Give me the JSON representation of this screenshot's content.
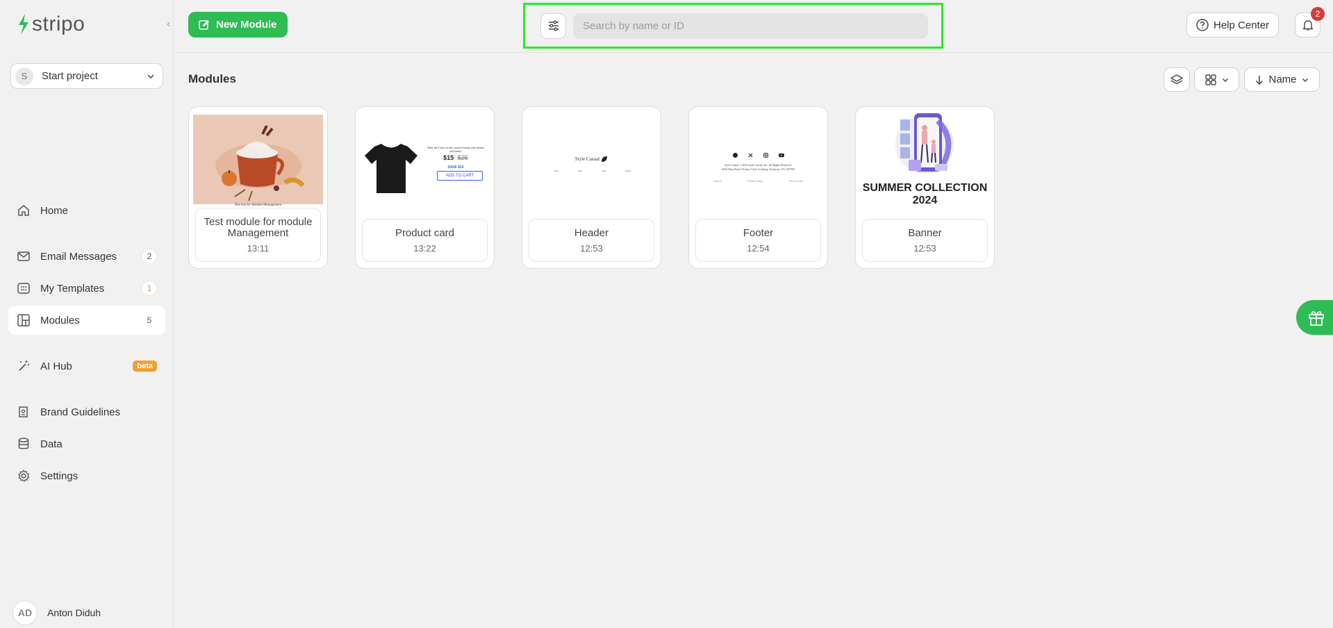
{
  "brand": {
    "logo_text": "stripo",
    "accent": "#2ebc54"
  },
  "project": {
    "avatar": "S",
    "name": "Start project"
  },
  "nav": {
    "home": {
      "label": "Home"
    },
    "email": {
      "label": "Email Messages",
      "count": "2"
    },
    "templates": {
      "label": "My Templates",
      "count": "1"
    },
    "modules": {
      "label": "Modules",
      "count": "5"
    },
    "ai": {
      "label": "AI Hub",
      "badge": "beta"
    },
    "brand": {
      "label": "Brand Guidelines"
    },
    "data": {
      "label": "Data"
    },
    "settings": {
      "label": "Settings"
    }
  },
  "user": {
    "initials": "AD",
    "name": "Anton Diduh"
  },
  "toolbar": {
    "new_module": "New Module"
  },
  "search": {
    "placeholder": "Search by name or ID"
  },
  "header": {
    "help": "Help Center",
    "notifications": "2"
  },
  "main": {
    "title": "Modules",
    "sort_label": "Name"
  },
  "cards": [
    {
      "name": "Test module for module Management",
      "time": "13:11",
      "thumb_caption": "Test text for Module Management"
    },
    {
      "name": "Product card",
      "time": "13:22",
      "thumb": {
        "text": "Wear the T-shirt on the casual evening with friends and family.",
        "price": "$15",
        "old_price": "$25",
        "save": "SAVE $10",
        "cta": "ADD TO CART"
      }
    },
    {
      "name": "Header",
      "time": "12:53",
      "thumb": {
        "brand": "Style Casual",
        "links": [
          "New",
          "Tops",
          "Sale",
          "About"
        ]
      }
    },
    {
      "name": "Footer",
      "time": "12:54",
      "thumb": {
        "copyright": "Style Casual © 2024 Style Casual, Inc. All Rights Reserved.",
        "address": "4642 Harp Road, Fiction, Clear Creeking, Kentucky, US, 047900",
        "links": [
          "Visit Us",
          "Privacy Policy",
          "Terms of Use"
        ]
      }
    },
    {
      "name": "Banner",
      "time": "12:53",
      "thumb": {
        "headline": "SUMMER COLLECTION 2024"
      }
    }
  ]
}
